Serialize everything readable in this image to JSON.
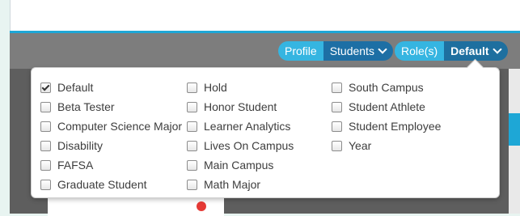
{
  "header": {
    "profile": {
      "label": "Profile",
      "value": "Students"
    },
    "roles": {
      "label": "Role(s)",
      "value": "Default"
    }
  },
  "dropdown": {
    "columns": [
      [
        {
          "label": "Default",
          "checked": true
        },
        {
          "label": "Beta Tester",
          "checked": false
        },
        {
          "label": "Computer Science Major",
          "checked": false
        },
        {
          "label": "Disability",
          "checked": false
        },
        {
          "label": "FAFSA",
          "checked": false
        },
        {
          "label": "Graduate Student",
          "checked": false
        }
      ],
      [
        {
          "label": "Hold",
          "checked": false
        },
        {
          "label": "Honor Student",
          "checked": false
        },
        {
          "label": "Learner Analytics",
          "checked": false
        },
        {
          "label": "Lives On Campus",
          "checked": false
        },
        {
          "label": "Main Campus",
          "checked": false
        },
        {
          "label": "Math Major",
          "checked": false
        }
      ],
      [
        {
          "label": "South Campus",
          "checked": false
        },
        {
          "label": "Student Athlete",
          "checked": false
        },
        {
          "label": "Student Employee",
          "checked": false
        },
        {
          "label": "Year",
          "checked": false
        }
      ]
    ]
  },
  "colors": {
    "accent_light": "#35b5e1",
    "accent_dark": "#1d6fa5",
    "header_gray": "#7d7d7d"
  }
}
